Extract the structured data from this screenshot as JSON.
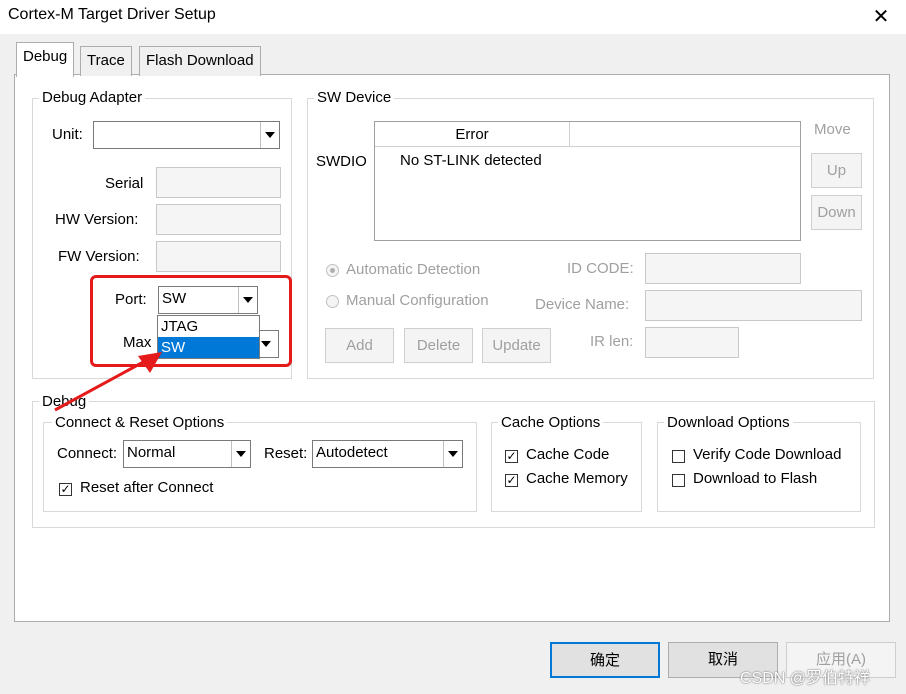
{
  "window": {
    "title": "Cortex-M Target Driver Setup",
    "close_glyph": "✕"
  },
  "tabs": [
    {
      "label": "Debug",
      "active": true
    },
    {
      "label": "Trace",
      "active": false
    },
    {
      "label": "Flash Download",
      "active": false
    }
  ],
  "debug_adapter": {
    "title": "Debug Adapter",
    "unit_label": "Unit:",
    "unit_value": "",
    "serial_label": "Serial",
    "hw_version_label": "HW Version:",
    "fw_version_label": "FW Version:",
    "port_label": "Port:",
    "port_value": "SW",
    "port_options": [
      "JTAG",
      "SW"
    ],
    "port_selected": "SW",
    "max_label": "Max"
  },
  "sw_device": {
    "title": "SW Device",
    "swdio_label": "SWDIO",
    "table_header_error": "Error",
    "table_header_blank": "",
    "table_row": "No ST-LINK detected",
    "move_label": "Move",
    "up_button": "Up",
    "down_button": "Down",
    "automatic_detection": "Automatic Detection",
    "manual_configuration": "Manual Configuration",
    "id_code_label": "ID CODE:",
    "device_name_label": "Device Name:",
    "ir_len_label": "IR len:",
    "add_button": "Add",
    "delete_button": "Delete",
    "update_button": "Update"
  },
  "debug": {
    "title": "Debug",
    "connect_reset": {
      "title": "Connect & Reset Options",
      "connect_label": "Connect:",
      "connect_value": "Normal",
      "reset_label": "Reset:",
      "reset_value": "Autodetect",
      "reset_after_connect": "Reset after Connect",
      "reset_after_connect_checked": true
    },
    "cache_options": {
      "title": "Cache Options",
      "cache_code": "Cache Code",
      "cache_code_checked": true,
      "cache_memory": "Cache Memory",
      "cache_memory_checked": true
    },
    "download_options": {
      "title": "Download Options",
      "verify_code_download": "Verify Code Download",
      "verify_checked": false,
      "download_to_flash": "Download to Flash",
      "download_checked": false
    }
  },
  "footer": {
    "ok_button": "确定",
    "cancel_button": "取消",
    "apply_button": "应用(A)"
  },
  "watermark": "CSDN @罗伯特祥",
  "colors": {
    "annotation_red": "#e51b1b",
    "selection_blue": "#0078d7"
  }
}
